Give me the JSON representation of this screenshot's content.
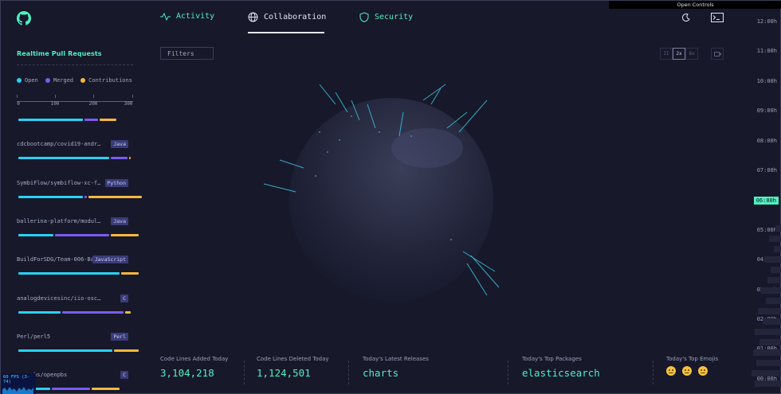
{
  "sidebar": {
    "title": "Realtime Pull Requests",
    "legend": [
      {
        "label": "Open",
        "color": "#2ad1f5"
      },
      {
        "label": "Merged",
        "color": "#7b5cf0"
      },
      {
        "label": "Contributions",
        "color": "#f5b83d"
      }
    ],
    "axis_ticks": [
      "0",
      "100",
      "200",
      "300"
    ],
    "rows": [
      {
        "name": "",
        "tag": "",
        "open": 180,
        "merged": 40,
        "contrib": 50
      },
      {
        "name": "cdcbootcamp/covid19-andr…",
        "tag": "Java",
        "open": 250,
        "merged": 50,
        "contrib": 10
      },
      {
        "name": "SymbiFlow/symbiflow-xc-f…",
        "tag": "Python",
        "open": 180,
        "merged": 10,
        "contrib": 150
      },
      {
        "name": "ballerina-platform/modul…",
        "tag": "Java",
        "open": 100,
        "merged": 150,
        "contrib": 80
      },
      {
        "name": "BuildForSDG/Team-006-Bac…",
        "tag": "JavaScript",
        "open": 280,
        "merged": 0,
        "contrib": 50
      },
      {
        "name": "analogdevicesinc/iio-osc…",
        "tag": "C",
        "open": 120,
        "merged": 170,
        "contrib": 20
      },
      {
        "name": "Perl/perl5",
        "tag": "Perl",
        "open": 260,
        "merged": 0,
        "contrib": 70
      },
      {
        "name": "openpbs/openpbs",
        "tag": "C",
        "open": 90,
        "merged": 110,
        "contrib": 80
      }
    ],
    "fps_label": "60 FPS (3-74)"
  },
  "nav": {
    "tabs": [
      {
        "label": "Activity",
        "icon": "activity-icon"
      },
      {
        "label": "Collaboration",
        "icon": "globe-icon"
      },
      {
        "label": "Security",
        "icon": "shield-icon"
      }
    ],
    "active_tab": "Collaboration"
  },
  "filters_label": "Filters",
  "speed_controls": [
    "II",
    "2x",
    "8x"
  ],
  "open_controls_label": "Open Controls",
  "stats": [
    {
      "label": "Code Lines Added Today",
      "value": "3,104,218"
    },
    {
      "label": "Code Lines Deleted Today",
      "value": "1,124,501"
    },
    {
      "label": "Today's Latest Releases",
      "value": "charts"
    },
    {
      "label": "Today's Top Packages",
      "value": "elasticsearch"
    },
    {
      "label": "Today's Top Emojis",
      "value": ""
    }
  ],
  "timeline": {
    "times": [
      "12:00h",
      "11:00h",
      "10:00h",
      "09:00h",
      "08:00h",
      "07:00h",
      "06:00h",
      "05:00h",
      "04:00h",
      "03:00h",
      "02:00h",
      "01:00h",
      "00:00h"
    ],
    "current": "06:00h"
  },
  "colors": {
    "accent": "#4ff0c0",
    "open": "#2ad1f5",
    "merged": "#7b5cf0",
    "contrib": "#f5b83d"
  }
}
